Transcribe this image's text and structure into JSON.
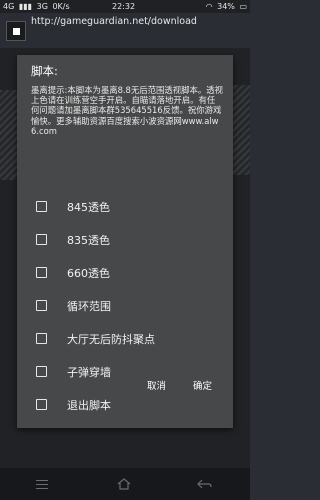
{
  "status_bar": {
    "signal_left": "4G",
    "bars": "▮▮▮",
    "signal_3g": "3G",
    "net_speed": "0K/s",
    "time": "22:32",
    "battery": "34%"
  },
  "header": {
    "url": "http://gameguardian.net/download"
  },
  "dialog": {
    "title": "脚本:",
    "message": "墨离提示:本脚本为墨离8.8无后范围透视脚本。透视上色请在训练营空手开启。自瞄请落地开启。有任何问题请加墨离脚本群535645516反馈。祝你游戏愉快。更多辅助资源百度搜索小波资源网www.alw6.com",
    "options": [
      {
        "label": "845透色",
        "checked": false
      },
      {
        "label": "835透色",
        "checked": false
      },
      {
        "label": "660透色",
        "checked": false
      },
      {
        "label": "循环范围",
        "checked": false
      },
      {
        "label": "大厅无后防抖聚点",
        "checked": false
      },
      {
        "label": "子弹穿墙",
        "checked": false
      },
      {
        "label": "退出脚本",
        "checked": false
      }
    ],
    "cancel_label": "取消",
    "ok_label": "确定"
  },
  "colors": {
    "dialog_bg": "#474849",
    "page_bg": "#2a2d33",
    "nav_bg": "#17181b"
  }
}
